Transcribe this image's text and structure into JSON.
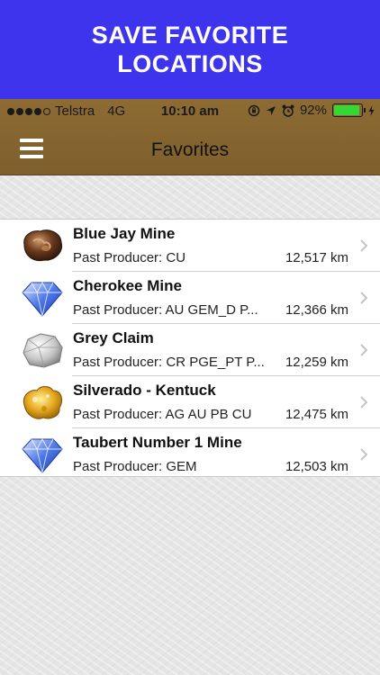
{
  "banner": {
    "line1": "SAVE FAVORITE",
    "line2": "LOCATIONS"
  },
  "status_bar": {
    "carrier": "Telstra",
    "network": "4G",
    "time": "10:10 am",
    "battery": "92%",
    "battery_level": 0.92
  },
  "nav": {
    "title": "Favorites"
  },
  "favorites": [
    {
      "name": "Blue Jay Mine",
      "producer": "Past Producer:  CU",
      "distance": "12,517 km",
      "icon": "copper-nugget-icon"
    },
    {
      "name": "Cherokee Mine",
      "producer": "Past Producer:  AU GEM_D P...",
      "distance": "12,366 km",
      "icon": "blue-gem-icon"
    },
    {
      "name": "Grey Claim",
      "producer": "Past Producer:  CR PGE_PT P...",
      "distance": "12,259 km",
      "icon": "silver-rock-icon"
    },
    {
      "name": "Silverado - Kentuck",
      "producer": "Past Producer:  AG AU PB CU",
      "distance": "12,475 km",
      "icon": "gold-nugget-icon"
    },
    {
      "name": "Taubert Number 1 Mine",
      "producer": "Past Producer:  GEM",
      "distance": "12,503 km",
      "icon": "blue-gem-icon"
    }
  ],
  "colors": {
    "banner": "#3f34ee",
    "navbar": "#8d6b33",
    "battery": "#35d832"
  }
}
